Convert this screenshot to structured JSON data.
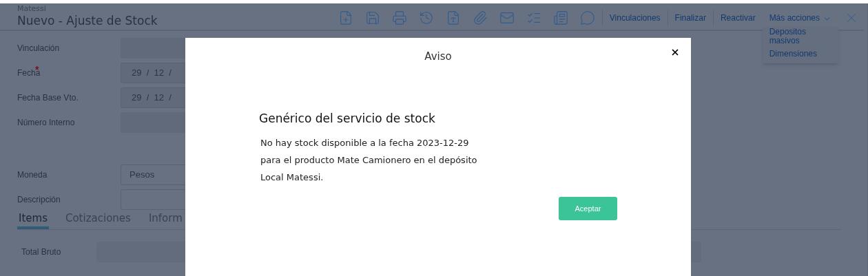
{
  "header": {
    "company": "Matessi",
    "title": "Nuevo - Ajuste de Stock"
  },
  "actions": [
    "Vinculaciones",
    "Finalizar",
    "Reactivar"
  ],
  "more_actions": {
    "label": "Más acciones",
    "expanded": true,
    "items": [
      "Depositos masivos",
      "Dimensiones"
    ]
  },
  "form": [
    {
      "label": "Vinculación",
      "kind": "empty"
    },
    {
      "label": "Fecha",
      "kind": "date",
      "required_mark": "*",
      "value": "29  /  12  /"
    },
    {
      "label": "Fecha Base Vto.",
      "kind": "date",
      "value": "29  /  12  /"
    },
    {
      "label": "Número Interno",
      "kind": "empty"
    },
    {
      "label": "Moneda",
      "kind": "select",
      "value": "Pesos"
    },
    {
      "label": "Descripción",
      "kind": "input"
    }
  ],
  "tabs": [
    {
      "label": "Items",
      "selected": true
    },
    {
      "label": "Cotizaciones",
      "selected": false
    },
    {
      "label": "Inform",
      "selected": false
    }
  ],
  "totals": [
    {
      "label": "Total Bruto"
    }
  ],
  "dialog": {
    "title": "Aviso",
    "heading": "Genérico del servicio de stock",
    "message": [
      "No hay stock disponible a la fecha 2023-12-29",
      "para el producto Mate Camionero en el depósito",
      "Local Matessi."
    ],
    "button": "Aceptar"
  }
}
